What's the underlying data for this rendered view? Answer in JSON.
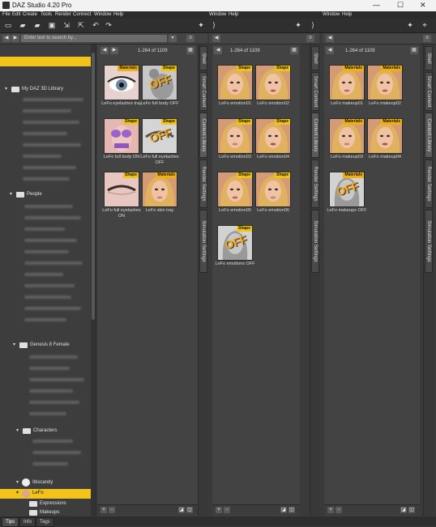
{
  "window": {
    "title": "DAZ Studio 4.20 Pro",
    "controls": {
      "minimize": "—",
      "maximize": "☐",
      "close": "✕"
    }
  },
  "menubar": {
    "main": [
      "File",
      "Edit",
      "Create",
      "Tools",
      "Render",
      "Connect",
      "Window",
      "Help"
    ],
    "floating1": [
      "Window",
      "Help"
    ],
    "floating2": [
      "Window",
      "Help"
    ]
  },
  "search": {
    "placeholder": "Enter text to search by..."
  },
  "pagination": {
    "panel1": "1-264 of 1109",
    "panel2": "1-264 of 1109",
    "panel3": "1-264 of 1109"
  },
  "tree": {
    "my_library": "My DAZ 3D Library",
    "people": "People",
    "genesis": "Genesis 8 Female",
    "characters": "Characters",
    "vendor": "Ibiscandy",
    "product": "LeFo",
    "sub1": "Expressions",
    "sub2": "Makeups"
  },
  "panel1_items": [
    {
      "label": "LeFo eyelashes tray",
      "badge": "Materials"
    },
    {
      "label": "LeFo full body OFF",
      "badge": "Shape"
    },
    {
      "label": "LeFo full body ON",
      "badge": "Shape"
    },
    {
      "label": "LeFo full eyelashes OFF",
      "badge": "Shape"
    },
    {
      "label": "LeFo full eyelashes ON",
      "badge": "Shape"
    },
    {
      "label": "LeFo skin tray",
      "badge": "Materials"
    }
  ],
  "panel2_items": [
    {
      "label": "LeFo emotion01",
      "badge": "Shape"
    },
    {
      "label": "LeFo emotion02",
      "badge": "Shape"
    },
    {
      "label": "LeFo emotion03",
      "badge": "Shape"
    },
    {
      "label": "LeFo emotion04",
      "badge": "Shape"
    },
    {
      "label": "LeFo emotion05",
      "badge": "Shape"
    },
    {
      "label": "LeFo emotion06",
      "badge": "Shape"
    },
    {
      "label": "LeFo emotions OFF",
      "badge": "Shape"
    }
  ],
  "panel3_items": [
    {
      "label": "LeFo makeup01",
      "badge": "Materials"
    },
    {
      "label": "LeFo makeup02",
      "badge": "Materials"
    },
    {
      "label": "LeFo makeup03",
      "badge": "Materials"
    },
    {
      "label": "LeFo makeup04",
      "badge": "Materials"
    },
    {
      "label": "LeFo makeups OFF",
      "badge": "Materials"
    }
  ],
  "off_text": "OFF",
  "side_tabs": [
    "Smart Content",
    "Content Library",
    "Render Settings",
    "Simulation Settings"
  ],
  "side_tab_short": "Shell",
  "bottom_tabs": [
    "Tips",
    "Info",
    "Tags"
  ],
  "colors": {
    "accent": "#f2c31b",
    "badge_shape": "#f1c40f",
    "badge_materials": "#f2b00f",
    "off_text": "#f6a712"
  }
}
